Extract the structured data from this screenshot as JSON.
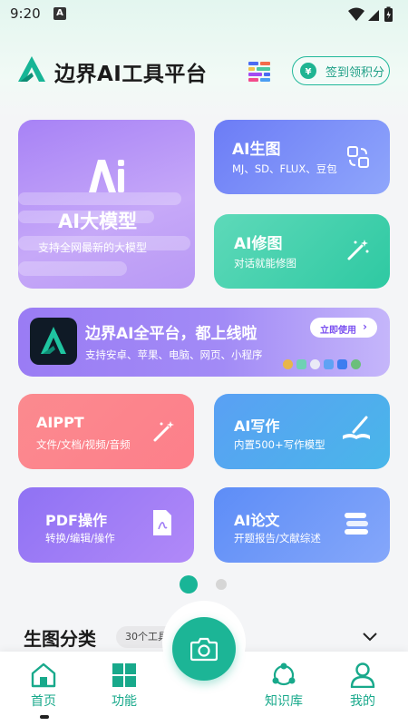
{
  "status_bar": {
    "time": "9:20",
    "notif_badge": "A"
  },
  "header": {
    "title": "边界AI工具平台",
    "signin_label": "签到领积分"
  },
  "cards": {
    "big_model": {
      "title": "AI大模型",
      "subtitle": "支持全网最新的大模型"
    },
    "image_gen": {
      "title": "AI生图",
      "subtitle": "MJ、SD、FLUX、豆包"
    },
    "image_fix": {
      "title": "AI修图",
      "subtitle": "对话就能修图"
    },
    "ppt": {
      "title": "AIPPT",
      "subtitle": "文件/文档/视频/音频"
    },
    "writing": {
      "title": "AI写作",
      "subtitle": "内置500+写作模型"
    },
    "pdf": {
      "title": "PDF操作",
      "subtitle": "转换/编辑/操作"
    },
    "paper": {
      "title": "AI论文",
      "subtitle": "开题报告/文献综述"
    }
  },
  "banner": {
    "title": "边界AI全平台，都上线啦",
    "subtitle": "支持安卓、苹果、电脑、网页、小程序",
    "button_label": "立即使用",
    "button_arrow": "›"
  },
  "pager": {
    "count": 2,
    "active": 1
  },
  "section": {
    "title": "生图分类",
    "count_label": "30个工具"
  },
  "tabbar": {
    "home": "首页",
    "functions": "功能",
    "knowledge": "知识库",
    "me": "我的"
  },
  "colors": {
    "accent": "#1cb596",
    "big_card": "#b394f6",
    "gen_card": "#7c90f8",
    "fix_card": "#43d1ae",
    "banner": "#a28bf6",
    "ppt_card": "#fc868c",
    "write_card": "#52abee",
    "pdf_card": "#a07ef6",
    "paper_card": "#719bf8"
  },
  "icons": [
    "logo-icon",
    "grid-menu-icon",
    "gift-coin-icon",
    "ai-logo-icon",
    "image-swap-icon",
    "magic-wand-icon",
    "book-pen-icon",
    "pdf-file-icon",
    "book-stack-icon",
    "camera-icon",
    "home-icon",
    "apps-grid-icon",
    "share-network-icon",
    "person-icon",
    "chevron-down-icon"
  ]
}
